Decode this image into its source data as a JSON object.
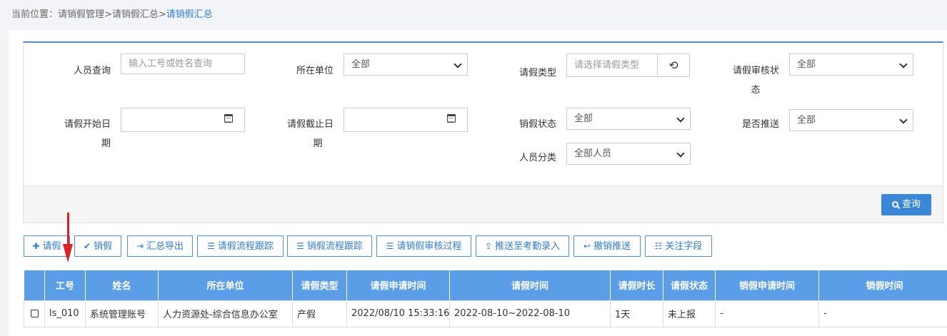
{
  "breadcrumb": {
    "prefix": "当前位置：请销假管理>请销假汇总>",
    "current": "请销假汇总"
  },
  "filters": {
    "person": {
      "label": "人员查询",
      "placeholder": "输入工号或姓名查询"
    },
    "unit": {
      "label": "所在单位",
      "value": "全部"
    },
    "leave_type": {
      "label": "请假类型",
      "placeholder": "请选择请假类型"
    },
    "audit_status": {
      "label_line1": "请假审核状",
      "label_line2": "态",
      "value": "全部"
    },
    "start_date": {
      "label_line1": "请假开始日",
      "label_line2": "期",
      "value": ""
    },
    "end_date": {
      "label_line1": "请假截止日",
      "label_line2": "期",
      "value": ""
    },
    "cancel_status": {
      "label": "销假状态",
      "value": "全部"
    },
    "pushed": {
      "label": "是否推送",
      "value": "全部"
    },
    "category": {
      "label": "人员分类",
      "value": "全部人员"
    }
  },
  "query_button": "查询",
  "toolbar": {
    "leave": "请假",
    "cancel": "销假",
    "export": "汇总导出",
    "leave_flow": "请假流程跟踪",
    "cancel_flow": "销假流程跟踪",
    "audit_flow": "请销假审核过程",
    "push": "推送至考勤录入",
    "revoke_push": "撤销推送",
    "fields": "关注字段"
  },
  "icons": {
    "leave": "plus-icon",
    "cancel": "check-icon",
    "export": "sign-out-icon",
    "leave_flow": "list-icon",
    "cancel_flow": "list-icon",
    "audit_flow": "list-icon",
    "push": "upload-icon",
    "revoke_push": "reply-icon",
    "fields": "th-list-icon",
    "reset": "reset-icon",
    "query": "search-icon",
    "date": "calendar-icon"
  },
  "table": {
    "headers": [
      "工号",
      "姓名",
      "所在单位",
      "请假类型",
      "请假申请时间",
      "请假时间",
      "请假时长",
      "请假状态",
      "销假申请时间",
      "销假时间"
    ],
    "rows": [
      [
        "ls_010",
        "系统管理账号",
        "人力资源处-综合信息办公室",
        "产假",
        "2022/08/10 15:33:16",
        "2022-08-10~2022-08-10",
        "1天",
        "未上报",
        "-",
        "-"
      ]
    ]
  },
  "colors": {
    "accent": "#3a87d8",
    "header_bg": "#5b9ee8",
    "annotation_arrow": "#e02020"
  }
}
